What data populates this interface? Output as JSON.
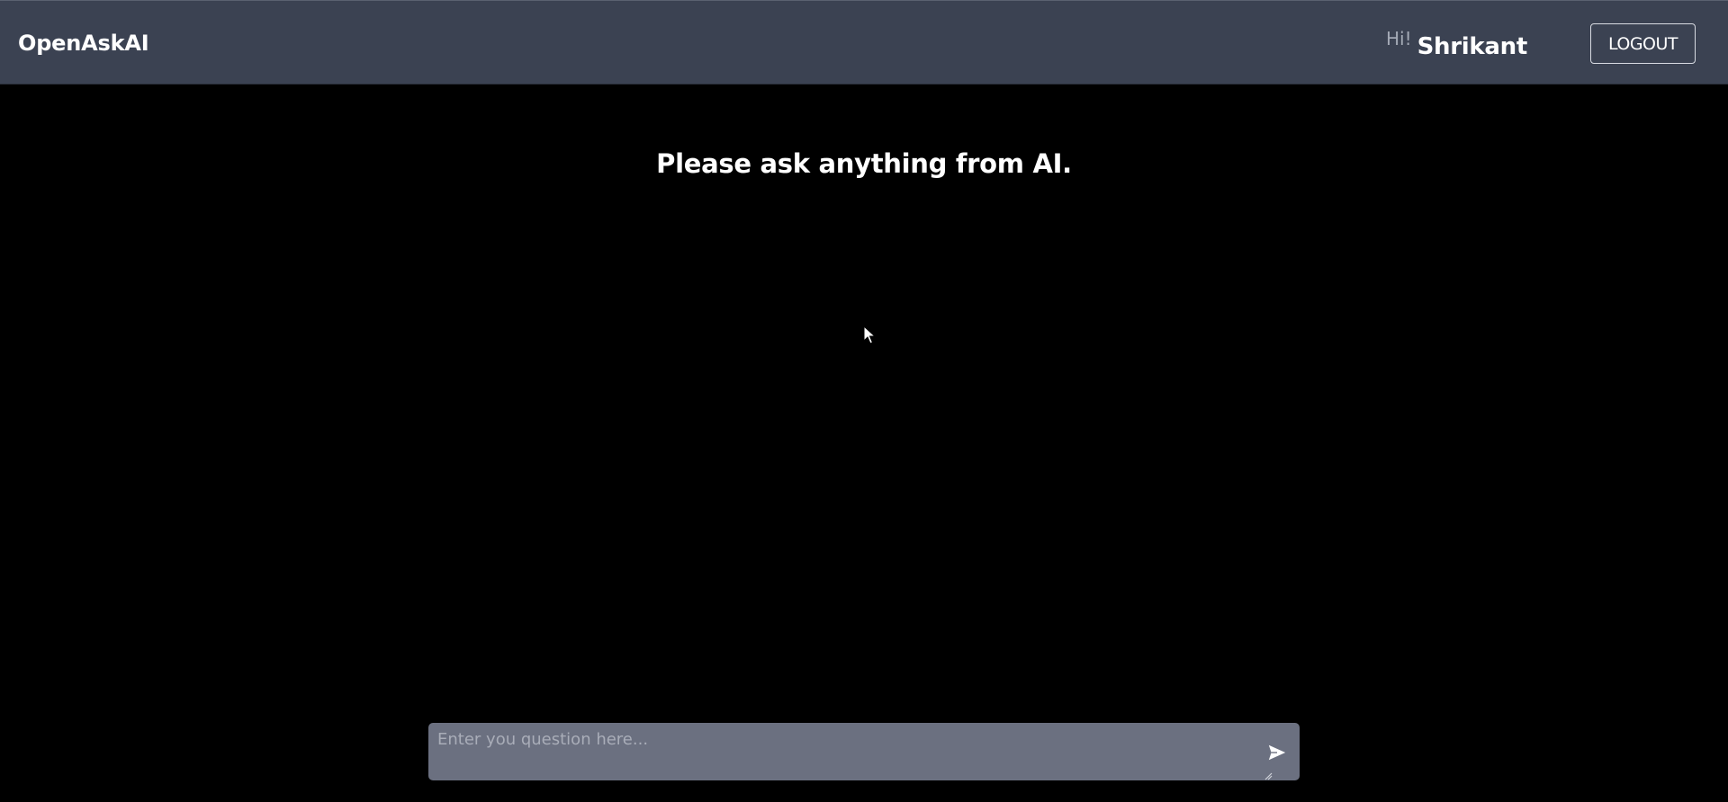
{
  "navbar": {
    "brand": "OpenAskAI",
    "greeting_prefix": "Hi!",
    "user_name": "Shrikant",
    "logout_label": "LOGOUT"
  },
  "main": {
    "prompt_title": "Please ask anything from AI."
  },
  "composer": {
    "placeholder": "Enter you question here...",
    "value": "",
    "send_icon": "send-icon"
  },
  "colors": {
    "navbar_bg": "#3b4252",
    "page_bg": "#000000",
    "composer_bg": "#6b7080"
  }
}
